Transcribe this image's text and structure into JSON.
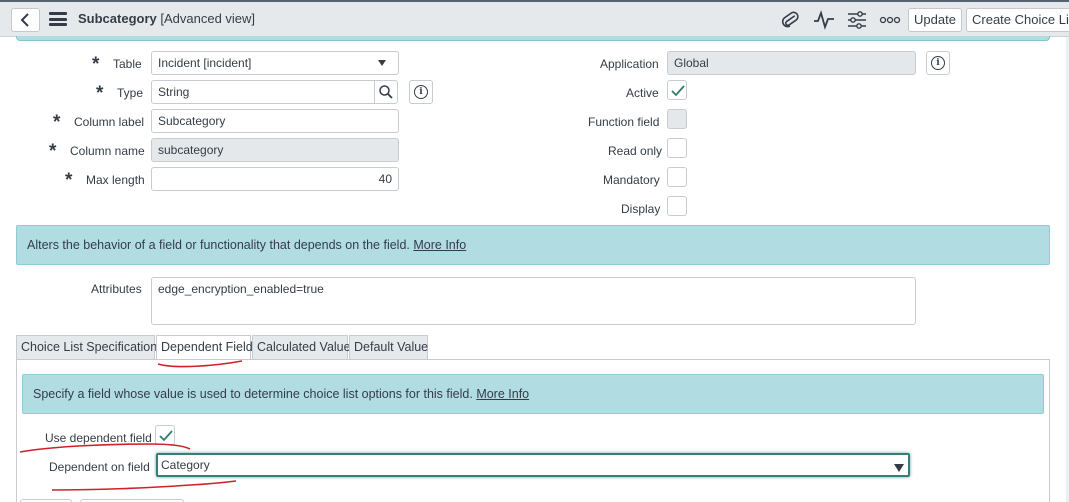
{
  "header": {
    "title": "Subcategory",
    "title_suffix": "[Advanced view]",
    "update_label": "Update",
    "create_choice_list_label": "Create Choice List",
    "icons": [
      "back-icon",
      "menu-icon",
      "attachment-icon",
      "activity-icon",
      "settings-icon",
      "more-icon"
    ]
  },
  "form": {
    "table": {
      "label": "Table",
      "value": "Incident [incident]"
    },
    "type": {
      "label": "Type",
      "value": "String"
    },
    "column_label": {
      "label": "Column label",
      "value": "Subcategory"
    },
    "column_name": {
      "label": "Column name",
      "value": "subcategory"
    },
    "max_length": {
      "label": "Max length",
      "value": "40"
    },
    "application": {
      "label": "Application",
      "value": "Global"
    },
    "active": {
      "label": "Active",
      "checked": true
    },
    "function_field": {
      "label": "Function field",
      "checked": false,
      "readonly": true
    },
    "read_only": {
      "label": "Read only",
      "checked": false
    },
    "mandatory": {
      "label": "Mandatory",
      "checked": false
    },
    "display": {
      "label": "Display",
      "checked": false
    }
  },
  "attributes_banner": {
    "text": "Alters the behavior of a field or functionality that depends on the field.",
    "link": "More Info"
  },
  "attributes": {
    "label": "Attributes",
    "value": "edge_encryption_enabled=true"
  },
  "tabs": [
    {
      "label": "Choice List Specification",
      "active": false
    },
    {
      "label": "Dependent Field",
      "active": true
    },
    {
      "label": "Calculated Value",
      "active": false
    },
    {
      "label": "Default Value",
      "active": false
    }
  ],
  "dependent": {
    "banner_text": "Specify a field whose value is used to determine choice list options for this field.",
    "banner_link": "More Info",
    "use_dependent_label": "Use dependent field",
    "use_dependent_checked": true,
    "dependent_on_label": "Dependent on field",
    "dependent_on_value": "Category"
  },
  "colors": {
    "header_bg": "#e6e9eb",
    "banner_bg": "#b1dde2",
    "check": "#2e7d6f",
    "annotation": "#d0202a"
  }
}
